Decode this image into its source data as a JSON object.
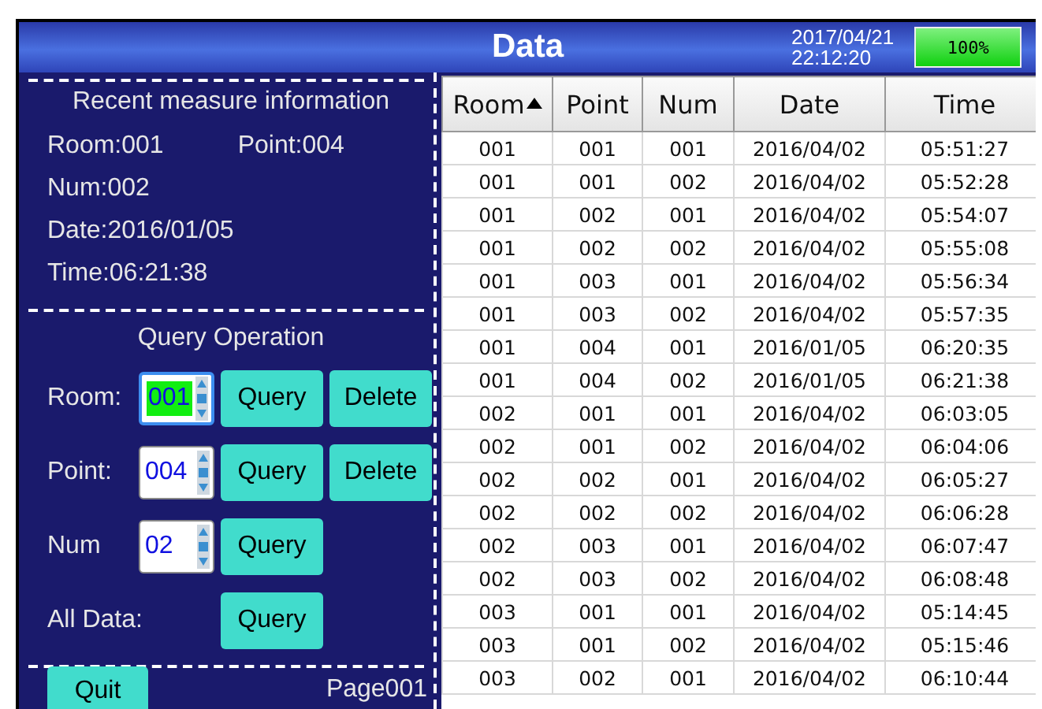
{
  "window": {
    "title": "Data",
    "date": "2017/04/21",
    "time": "22:12:20"
  },
  "battery": {
    "label": "100%",
    "level": 1
  },
  "recent": {
    "title": "Recent measure information",
    "room": "Room:001",
    "point": "Point:004",
    "num": "Num:002",
    "date": "Date:2016/01/05",
    "time": "Time:06:21:38"
  },
  "query": {
    "title": "Query Operation",
    "rows": [
      {
        "label": "Room:",
        "value": "001",
        "focused": true,
        "buttons": [
          "Query",
          "Delete"
        ]
      },
      {
        "label": "Point:",
        "value": "004",
        "focused": false,
        "buttons": [
          "Query",
          "Delete"
        ]
      },
      {
        "label": "Num",
        "value": "02",
        "focused": false,
        "buttons": [
          "Query"
        ]
      },
      {
        "label": "All Data:",
        "buttons": [
          "Query"
        ]
      }
    ]
  },
  "footer": {
    "quit": "Quit",
    "page": "Page001"
  },
  "table": {
    "columns": [
      {
        "label": "Room",
        "sorted": true
      },
      {
        "label": "Point",
        "sorted": false
      },
      {
        "label": "Num",
        "sorted": false
      },
      {
        "label": "Date",
        "sorted": false
      },
      {
        "label": "Time",
        "sorted": false
      }
    ],
    "rows": [
      [
        "001",
        "001",
        "001",
        "2016/04/02",
        "05:51:27"
      ],
      [
        "001",
        "001",
        "002",
        "2016/04/02",
        "05:52:28"
      ],
      [
        "001",
        "002",
        "001",
        "2016/04/02",
        "05:54:07"
      ],
      [
        "001",
        "002",
        "002",
        "2016/04/02",
        "05:55:08"
      ],
      [
        "001",
        "003",
        "001",
        "2016/04/02",
        "05:56:34"
      ],
      [
        "001",
        "003",
        "002",
        "2016/04/02",
        "05:57:35"
      ],
      [
        "001",
        "004",
        "001",
        "2016/01/05",
        "06:20:35"
      ],
      [
        "001",
        "004",
        "002",
        "2016/01/05",
        "06:21:38"
      ],
      [
        "002",
        "001",
        "001",
        "2016/04/02",
        "06:03:05"
      ],
      [
        "002",
        "001",
        "002",
        "2016/04/02",
        "06:04:06"
      ],
      [
        "002",
        "002",
        "001",
        "2016/04/02",
        "06:05:27"
      ],
      [
        "002",
        "002",
        "002",
        "2016/04/02",
        "06:06:28"
      ],
      [
        "002",
        "003",
        "001",
        "2016/04/02",
        "06:07:47"
      ],
      [
        "002",
        "003",
        "002",
        "2016/04/02",
        "06:08:48"
      ],
      [
        "003",
        "001",
        "001",
        "2016/04/02",
        "05:14:45"
      ],
      [
        "003",
        "001",
        "002",
        "2016/04/02",
        "05:15:46"
      ],
      [
        "003",
        "002",
        "001",
        "2016/04/02",
        "06:10:44"
      ]
    ]
  }
}
